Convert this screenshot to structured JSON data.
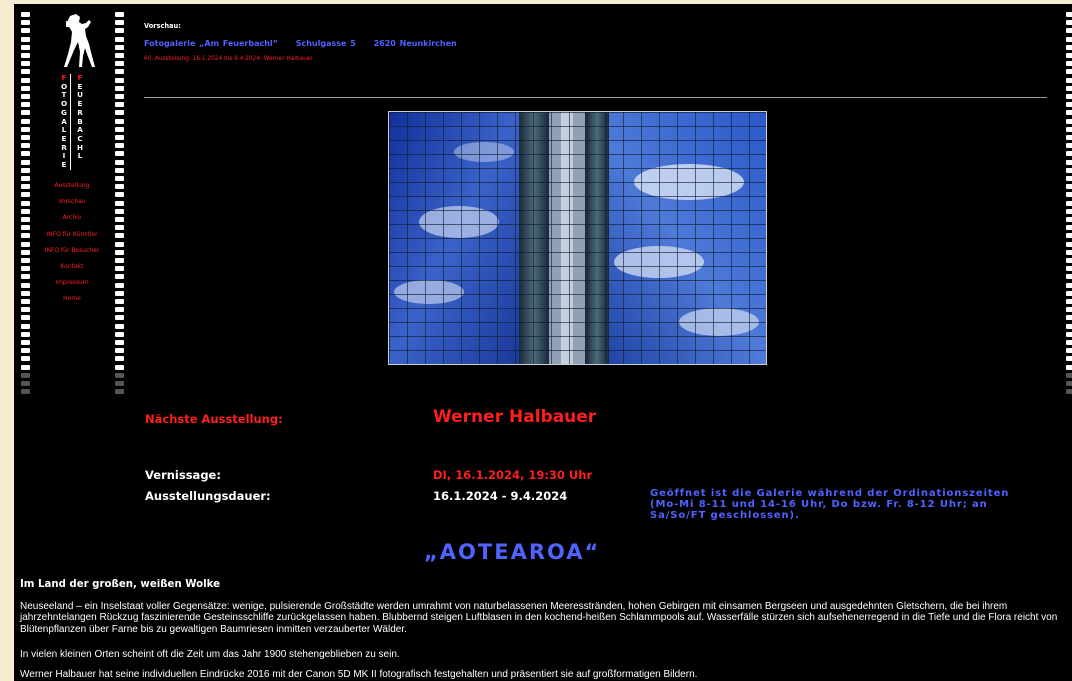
{
  "logo": {
    "word1": [
      "F",
      "O",
      "T",
      "O",
      "G",
      "A",
      "L",
      "E",
      "R",
      "I",
      "E"
    ],
    "word2": [
      "F",
      "E",
      "U",
      "E",
      "R",
      "B",
      "A",
      "C",
      "H",
      "L"
    ]
  },
  "nav": {
    "items": [
      {
        "label": "Ausstellung"
      },
      {
        "label": "Vorschau"
      },
      {
        "label": "Archiv"
      },
      {
        "label": "INFO für Künstler"
      },
      {
        "label": "INFO für Besucher"
      },
      {
        "label": "Kontakt"
      },
      {
        "label": "Impressum"
      },
      {
        "label": "Home"
      }
    ]
  },
  "header": {
    "vorschau": "Vorschau:",
    "gallery_name": "Fotogalerie „Am Feuerbachl“",
    "street": "Schulgasse 5",
    "city": "2620 Neunkirchen",
    "exhibit_line": "60. Ausstellung: 16.1.2024 bis 9.4.2024: Werner Halbauer"
  },
  "exhibition": {
    "next_label": "Nächste Ausstellung:",
    "artist": "Werner Halbauer",
    "vernissage_label": "Vernissage:",
    "vernissage_value": "DI, 16.1.2024, 19:30 Uhr",
    "duration_label": "Ausstellungsdauer:",
    "duration_value": "16.1.2024 - 9.4.2024",
    "opening_hours": "Geöffnet ist die Galerie während der Ordinationszeiten (Mo-Mi 8-11 und 14-16 Uhr, Do bzw. Fr. 8-12 Uhr; an Sa/So/FT geschlossen).",
    "title": "„AOTEAROA“"
  },
  "body": {
    "heading": "Im Land der großen, weißen Wolke",
    "para1": "Neuseeland – ein Inselstaat voller Gegensätze: wenige, pulsierende Großstädte werden umrahmt von naturbelassenen Meeresstränden, hohen Gebirgen mit einsamen Bergseen und ausgedehnten Gletschern, die bei ihrem jahrzehntelangen Rückzug faszinierende Gesteinsschliffe zurückgelassen haben. Blubbernd steigen Luftblasen in den kochend-heißen Schlammpools auf. Wasserfälle stürzen sich aufsehenerregend in die Tiefe und die Flora reicht von Blütenpflanzen über Farne bis zu gewaltigen Baumriesen inmitten verzauberter Wälder.",
    "para2": "In vielen kleinen Orten scheint oft die Zeit um das Jahr 1900 stehengeblieben zu sein.",
    "para3": "Werner Halbauer hat seine individuellen Eindrücke 2016 mit der Canon 5D MK II fotografisch festgehalten und präsentiert sie auf großformatigen Bildern."
  },
  "colors": {
    "background": "#000000",
    "outer": "#f6ecd2",
    "accent_red": "#ff1e1e",
    "accent_blue": "#4f63ff"
  }
}
